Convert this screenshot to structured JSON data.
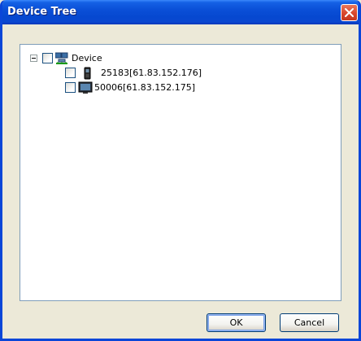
{
  "window": {
    "title": "Device Tree"
  },
  "tree": {
    "root": {
      "label": "Device",
      "icon": "network-devices-icon",
      "expanded": true,
      "checked": false
    },
    "children": [
      {
        "label": "25183[61.83.152.176]",
        "icon": "terminal-device-icon",
        "checked": false
      },
      {
        "label": "50006[61.83.152.175]",
        "icon": "monitor-device-icon",
        "checked": false
      }
    ]
  },
  "buttons": {
    "ok": "OK",
    "cancel": "Cancel"
  },
  "colors": {
    "titlebar": "#0a4fd7",
    "frame": "#0a46d8",
    "close": "#d8472d",
    "dialog_bg": "#ece9d8"
  }
}
